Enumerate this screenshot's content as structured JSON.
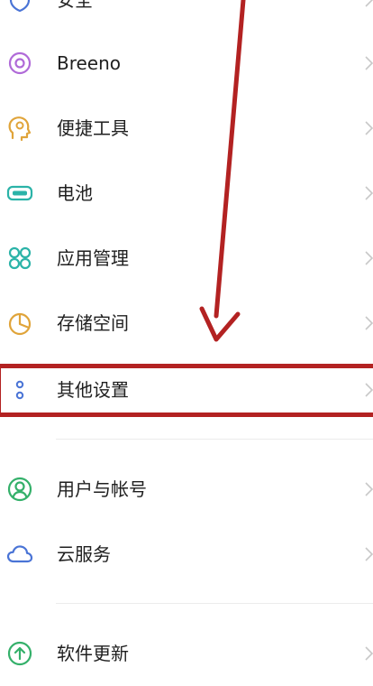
{
  "items": [
    {
      "label": "安全",
      "icon": "shield-icon"
    },
    {
      "label": "Breeno",
      "icon": "breeno-icon"
    },
    {
      "label": "便捷工具",
      "icon": "convenience-tools-icon"
    },
    {
      "label": "电池",
      "icon": "battery-icon"
    },
    {
      "label": "应用管理",
      "icon": "app-grid-icon"
    },
    {
      "label": "存储空间",
      "icon": "storage-pie-icon"
    },
    {
      "label": "其他设置",
      "icon": "more-dots-icon"
    },
    {
      "label": "用户与帐号",
      "icon": "user-icon"
    },
    {
      "label": "云服务",
      "icon": "cloud-icon"
    },
    {
      "label": "软件更新",
      "icon": "update-icon"
    }
  ],
  "chevron_icon": "chevron-right-icon",
  "annotation": {
    "color": "#b32222"
  }
}
